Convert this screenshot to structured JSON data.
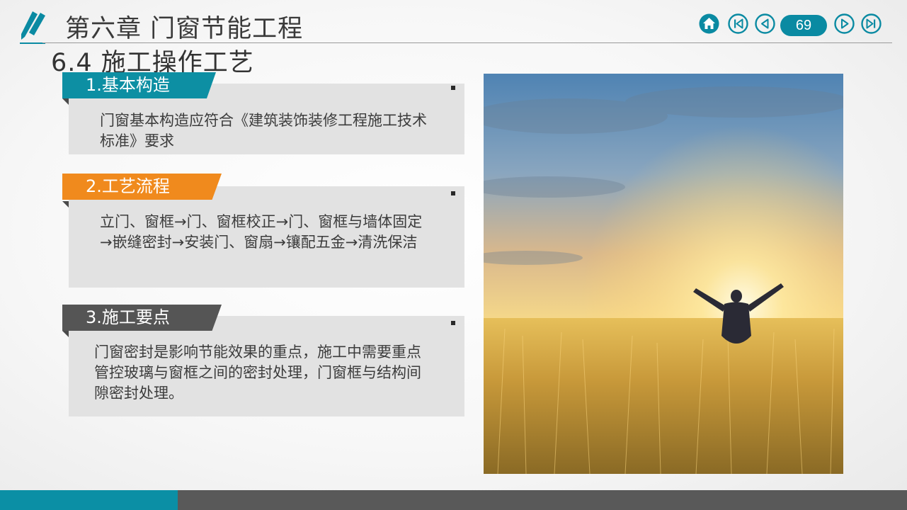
{
  "header": {
    "logo_icon": "pencil-icon",
    "chapter_title": "第六章  门窗节能工程",
    "section_title": "6.4  施工操作工艺",
    "accent_color": "#0a8aa2"
  },
  "nav": {
    "home_icon": "home-icon",
    "first_icon": "skip-first-icon",
    "prev_icon": "prev-icon",
    "page_number": "69",
    "next_icon": "next-icon",
    "last_icon": "skip-last-icon"
  },
  "cards": [
    {
      "tab_label": "1.基本构造",
      "tab_color": "#0d8fa3",
      "text": "门窗基本构造应符合《建筑装饰装修工程施工技术标准》要求"
    },
    {
      "tab_label": "2.工艺流程",
      "tab_color": "#f08a1d",
      "text": "立门、窗框→门、窗框校正→门、窗框与墙体固定→嵌缝密封→安装门、窗扇→镶配五金→清洗保洁"
    },
    {
      "tab_label": "3.施工要点",
      "tab_color": "#555555",
      "text": "门窗密封是影响节能效果的重点，施工中需要重点管控玻璃与窗框之间的密封处理，门窗框与结构间隙密封处理。"
    }
  ],
  "photo": {
    "subject": "man-in-wheat-field-at-sunrise"
  },
  "footer": {
    "teal": "#0b8fa5",
    "dark": "#595959"
  }
}
